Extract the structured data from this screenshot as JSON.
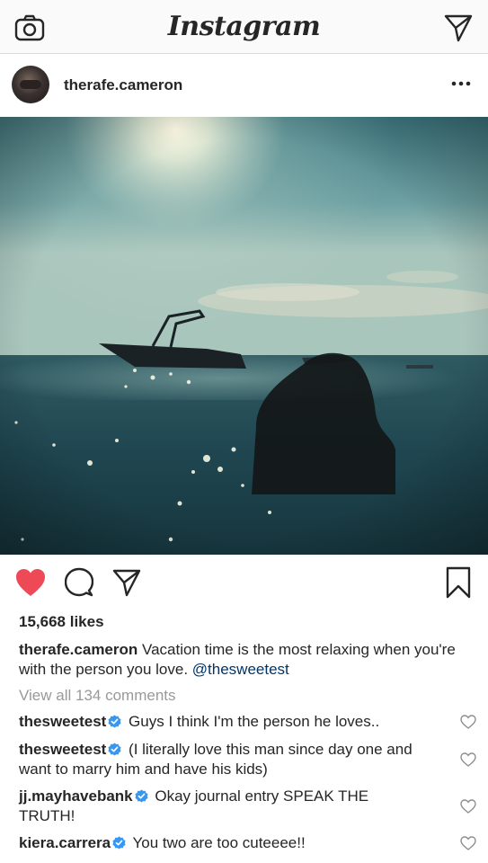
{
  "topbar": {
    "logo": "Instagram",
    "camera_icon": "camera-icon",
    "direct_icon": "direct-message-icon"
  },
  "post": {
    "username": "therafe.cameron",
    "more_icon": "more-options-icon",
    "image_alt": "Person in the sea at sunset with a boat",
    "liked": true,
    "likes": "15,668 likes",
    "caption": {
      "username": "therafe.cameron",
      "text": " Vacation time is the most relaxing when you're with the person you love. ",
      "mention": "@thesweetest"
    },
    "view_all": "View all 134 comments",
    "comments": [
      {
        "username": "thesweetest",
        "text": "Guys I think I'm the person he loves.."
      },
      {
        "username": "thesweetest",
        "text": "(I literally love this man since day one and want to marry him and have his kids)"
      },
      {
        "username": "jj.mayhavebank",
        "text": "Okay journal entry SPEAK THE TRUTH!"
      },
      {
        "username": "kiera.carrera",
        "text": "You two are too cuteeee!!"
      }
    ]
  },
  "colors": {
    "like_red": "#ed4956",
    "verified_blue": "#3897f0",
    "mention_blue": "#003569",
    "muted_gray": "#999999"
  }
}
